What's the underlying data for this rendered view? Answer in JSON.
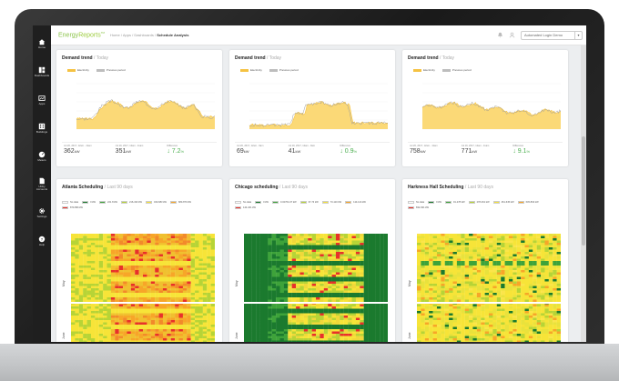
{
  "topbar": {
    "brand_energy": "Energy",
    "brand_reports": "Reports",
    "brand_tm": "TM",
    "breadcrumb": [
      "Home",
      "Apps",
      "Dashboards"
    ],
    "breadcrumb_current": "Schedule Analysis",
    "login_label": "Automated Login Demo"
  },
  "sidebar": {
    "items": [
      {
        "label": "Home",
        "icon": "home-icon"
      },
      {
        "label": "Dashboards",
        "icon": "dashboard-icon"
      },
      {
        "label": "Apps",
        "icon": "apps-icon"
      },
      {
        "label": "Buildings",
        "icon": "building-icon"
      },
      {
        "label": "Meters",
        "icon": "meter-icon"
      },
      {
        "label": "Utility Accounts",
        "icon": "utility-account-icon"
      },
      {
        "label": "Settings",
        "icon": "gear-icon"
      },
      {
        "label": "Help",
        "icon": "help-icon"
      }
    ]
  },
  "demand_cards": [
    {
      "title": "Demand trend",
      "subtitle": "Today",
      "legend": [
        "Electricity",
        "Previous period"
      ],
      "stats": [
        {
          "label": "Jul 20, 2017, 12am - 11am",
          "value": "362",
          "unit": "kW"
        },
        {
          "label": "Jul 19, 2017, 12am - 11am",
          "value": "351",
          "unit": "kW"
        },
        {
          "label": "Difference",
          "value": "7.2",
          "unit": "%"
        }
      ]
    },
    {
      "title": "Demand trend",
      "subtitle": "Today",
      "legend": [
        "Electricity",
        "Previous period"
      ],
      "stats": [
        {
          "label": "Jul 20, 2017, 12am - 9am",
          "value": "69",
          "unit": "kW"
        },
        {
          "label": "Jul 19, 2017, 12am - 9am",
          "value": "41",
          "unit": "kW"
        },
        {
          "label": "Difference",
          "value": "0.9",
          "unit": "%"
        }
      ]
    },
    {
      "title": "Demand trend",
      "subtitle": "Today",
      "legend": [
        "Electricity",
        "Previous period"
      ],
      "stats": [
        {
          "label": "Jul 20, 2017, 12am - 11am",
          "value": "758",
          "unit": "kW"
        },
        {
          "label": "Jul 19, 2017, 12am - 11am",
          "value": "771",
          "unit": "kW"
        },
        {
          "label": "Difference",
          "value": "9.1",
          "unit": "%"
        }
      ]
    }
  ],
  "schedule_cards": [
    {
      "title": "Atlanta Scheduling",
      "subtitle": "Last 90 days",
      "legend": [
        "No data",
        "0 kW",
        "221.8 kW",
        "216-433 kW",
        "433-683 kW",
        "683-870 kW",
        "870-896 kW"
      ],
      "months": [
        "May",
        "June"
      ],
      "scheme": "warm"
    },
    {
      "title": "Chicago scheduling",
      "subtitle": "Last 90 days",
      "legend": [
        "No data",
        "0 kW",
        "0.32764-37 kW",
        "37-73 kW",
        "73-110 kW",
        "110-144 kW",
        "144-161 kW"
      ],
      "months": [
        "May",
        "June"
      ],
      "scheme": "green"
    },
    {
      "title": "Harkness Hall Scheduling",
      "subtitle": "Last 90 days",
      "legend": [
        "No data",
        "0 kW",
        "91-278 kW",
        "278-461 kW",
        "461-645 kW",
        "645-832 kW",
        "832-931 kW"
      ],
      "months": [
        "May",
        "June"
      ],
      "scheme": "yellow"
    }
  ],
  "colors": {
    "electricity": "#f5c242",
    "electricity_fill": "#fbd977",
    "previous": "#bdbdbd",
    "diff_positive": "#4caf50",
    "legend_swatches": [
      "#ffffff",
      "#1b7a2e",
      "#3ea33a",
      "#b7d436",
      "#f7e438",
      "#f7a628",
      "#e8312a"
    ]
  }
}
